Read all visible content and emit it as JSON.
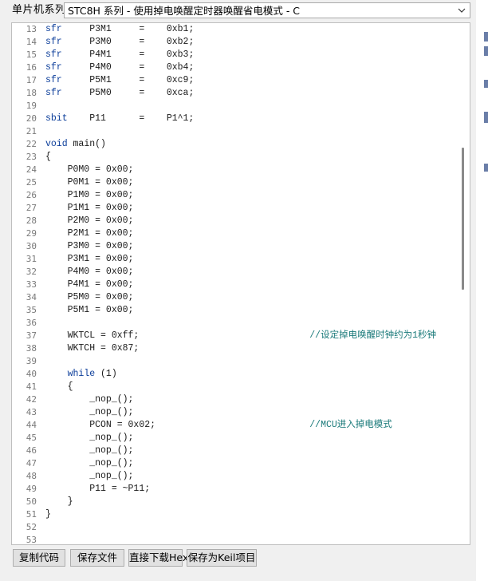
{
  "header": {
    "label": "单片机系列",
    "selected": "STC8H 系列 - 使用掉电唤醒定时器唤醒省电模式 - C",
    "dropdown_icon": "chevron-down-icon"
  },
  "editor": {
    "lines": [
      {
        "n": "13",
        "segments": [
          {
            "t": "sfr",
            "c": "kw"
          },
          {
            "t": "     P3M1     =    0xb1;"
          }
        ]
      },
      {
        "n": "14",
        "segments": [
          {
            "t": "sfr",
            "c": "kw"
          },
          {
            "t": "     P3M0     =    0xb2;"
          }
        ]
      },
      {
        "n": "15",
        "segments": [
          {
            "t": "sfr",
            "c": "kw"
          },
          {
            "t": "     P4M1     =    0xb3;"
          }
        ]
      },
      {
        "n": "16",
        "segments": [
          {
            "t": "sfr",
            "c": "kw"
          },
          {
            "t": "     P4M0     =    0xb4;"
          }
        ]
      },
      {
        "n": "17",
        "segments": [
          {
            "t": "sfr",
            "c": "kw"
          },
          {
            "t": "     P5M1     =    0xc9;"
          }
        ]
      },
      {
        "n": "18",
        "segments": [
          {
            "t": "sfr",
            "c": "kw"
          },
          {
            "t": "     P5M0     =    0xca;"
          }
        ]
      },
      {
        "n": "19",
        "segments": []
      },
      {
        "n": "20",
        "segments": [
          {
            "t": "sbit",
            "c": "kw"
          },
          {
            "t": "    P11      =    P1^1;"
          }
        ]
      },
      {
        "n": "21",
        "segments": []
      },
      {
        "n": "22",
        "segments": [
          {
            "t": "void",
            "c": "kw"
          },
          {
            "t": " main()"
          }
        ]
      },
      {
        "n": "23",
        "segments": [
          {
            "t": "{"
          }
        ]
      },
      {
        "n": "24",
        "segments": [
          {
            "t": "    P0M0 = 0x00;"
          }
        ]
      },
      {
        "n": "25",
        "segments": [
          {
            "t": "    P0M1 = 0x00;"
          }
        ]
      },
      {
        "n": "26",
        "segments": [
          {
            "t": "    P1M0 = 0x00;"
          }
        ]
      },
      {
        "n": "27",
        "segments": [
          {
            "t": "    P1M1 = 0x00;"
          }
        ]
      },
      {
        "n": "28",
        "segments": [
          {
            "t": "    P2M0 = 0x00;"
          }
        ]
      },
      {
        "n": "29",
        "segments": [
          {
            "t": "    P2M1 = 0x00;"
          }
        ]
      },
      {
        "n": "30",
        "segments": [
          {
            "t": "    P3M0 = 0x00;"
          }
        ]
      },
      {
        "n": "31",
        "segments": [
          {
            "t": "    P3M1 = 0x00;"
          }
        ]
      },
      {
        "n": "32",
        "segments": [
          {
            "t": "    P4M0 = 0x00;"
          }
        ]
      },
      {
        "n": "33",
        "segments": [
          {
            "t": "    P4M1 = 0x00;"
          }
        ]
      },
      {
        "n": "34",
        "segments": [
          {
            "t": "    P5M0 = 0x00;"
          }
        ]
      },
      {
        "n": "35",
        "segments": [
          {
            "t": "    P5M1 = 0x00;"
          }
        ]
      },
      {
        "n": "36",
        "segments": []
      },
      {
        "n": "37",
        "segments": [
          {
            "t": "    WKTCL = 0xff;                               "
          },
          {
            "t": "//设定掉电唤醒时钟约为1秒钟",
            "c": "cm"
          }
        ]
      },
      {
        "n": "38",
        "segments": [
          {
            "t": "    WKTCH = 0x87;"
          }
        ]
      },
      {
        "n": "39",
        "segments": []
      },
      {
        "n": "40",
        "segments": [
          {
            "t": "    "
          },
          {
            "t": "while",
            "c": "kw"
          },
          {
            "t": " (1)"
          }
        ]
      },
      {
        "n": "41",
        "segments": [
          {
            "t": "    {"
          }
        ]
      },
      {
        "n": "42",
        "segments": [
          {
            "t": "        _nop_();"
          }
        ]
      },
      {
        "n": "43",
        "segments": [
          {
            "t": "        _nop_();"
          }
        ]
      },
      {
        "n": "44",
        "segments": [
          {
            "t": "        PCON = 0x02;                            "
          },
          {
            "t": "//MCU进入掉电模式",
            "c": "cm"
          }
        ]
      },
      {
        "n": "45",
        "segments": [
          {
            "t": "        _nop_();"
          }
        ]
      },
      {
        "n": "46",
        "segments": [
          {
            "t": "        _nop_();"
          }
        ]
      },
      {
        "n": "47",
        "segments": [
          {
            "t": "        _nop_();"
          }
        ]
      },
      {
        "n": "48",
        "segments": [
          {
            "t": "        _nop_();"
          }
        ]
      },
      {
        "n": "49",
        "segments": [
          {
            "t": "        P11 = ~P11;"
          }
        ]
      },
      {
        "n": "50",
        "segments": [
          {
            "t": "    }"
          }
        ]
      },
      {
        "n": "51",
        "segments": [
          {
            "t": "}"
          }
        ]
      },
      {
        "n": "52",
        "segments": []
      },
      {
        "n": "53",
        "segments": []
      }
    ]
  },
  "buttons": {
    "copy": "复制代码",
    "save_file": "保存文件",
    "download_hex": "直接下载Hex",
    "save_keil": "保存为Keil项目"
  },
  "colors": {
    "keyword": "#0b3d9a",
    "comment": "#1a7a7a",
    "line_number": "#7a7a7a"
  }
}
